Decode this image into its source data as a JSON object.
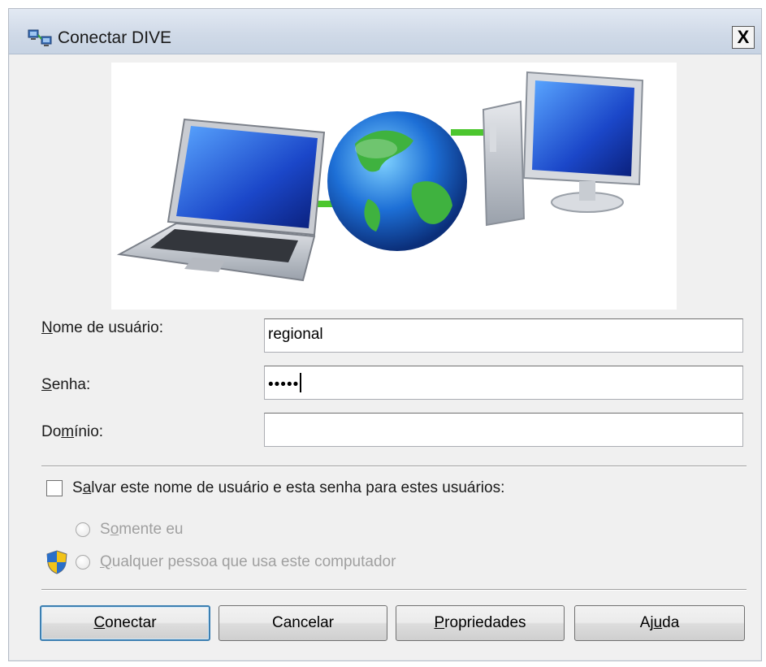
{
  "window": {
    "title": "Conectar DIVE",
    "close_label": "X"
  },
  "form": {
    "username_label": {
      "u": "N",
      "rest": "ome de usuário:"
    },
    "username_value": "regional",
    "password_label": {
      "u": "S",
      "rest": "enha:"
    },
    "password_value": "•••••",
    "domain_label": {
      "pre": "Do",
      "u": "m",
      "rest": "ínio:"
    },
    "domain_value": ""
  },
  "save_options": {
    "checkbox_label": {
      "pre": "S",
      "u": "a",
      "rest": "lvar este nome de usuário e esta senha para estes usuários:"
    },
    "checked": false,
    "radio_only_me": {
      "pre": "S",
      "u": "o",
      "rest": "mente eu"
    },
    "radio_anyone": {
      "u": "Q",
      "rest": "ualquer pessoa que usa este computador"
    }
  },
  "buttons": {
    "connect": {
      "u": "C",
      "rest": "onectar"
    },
    "cancel": "Cancelar",
    "properties": {
      "u": "P",
      "rest": "ropriedades"
    },
    "help": {
      "pre": "Aj",
      "u": "u",
      "rest": "da"
    }
  },
  "icons": {
    "title": "network-connection-icon",
    "banner": "laptop-globe-desktop-network-illustration",
    "shield": "uac-shield-icon"
  },
  "colors": {
    "titlebar": "#cfd9e7",
    "dialog_bg": "#f0f0f0",
    "default_button_border": "#3c7fb1",
    "shield_blue": "#2a6fc9",
    "shield_yellow": "#f2c318"
  }
}
